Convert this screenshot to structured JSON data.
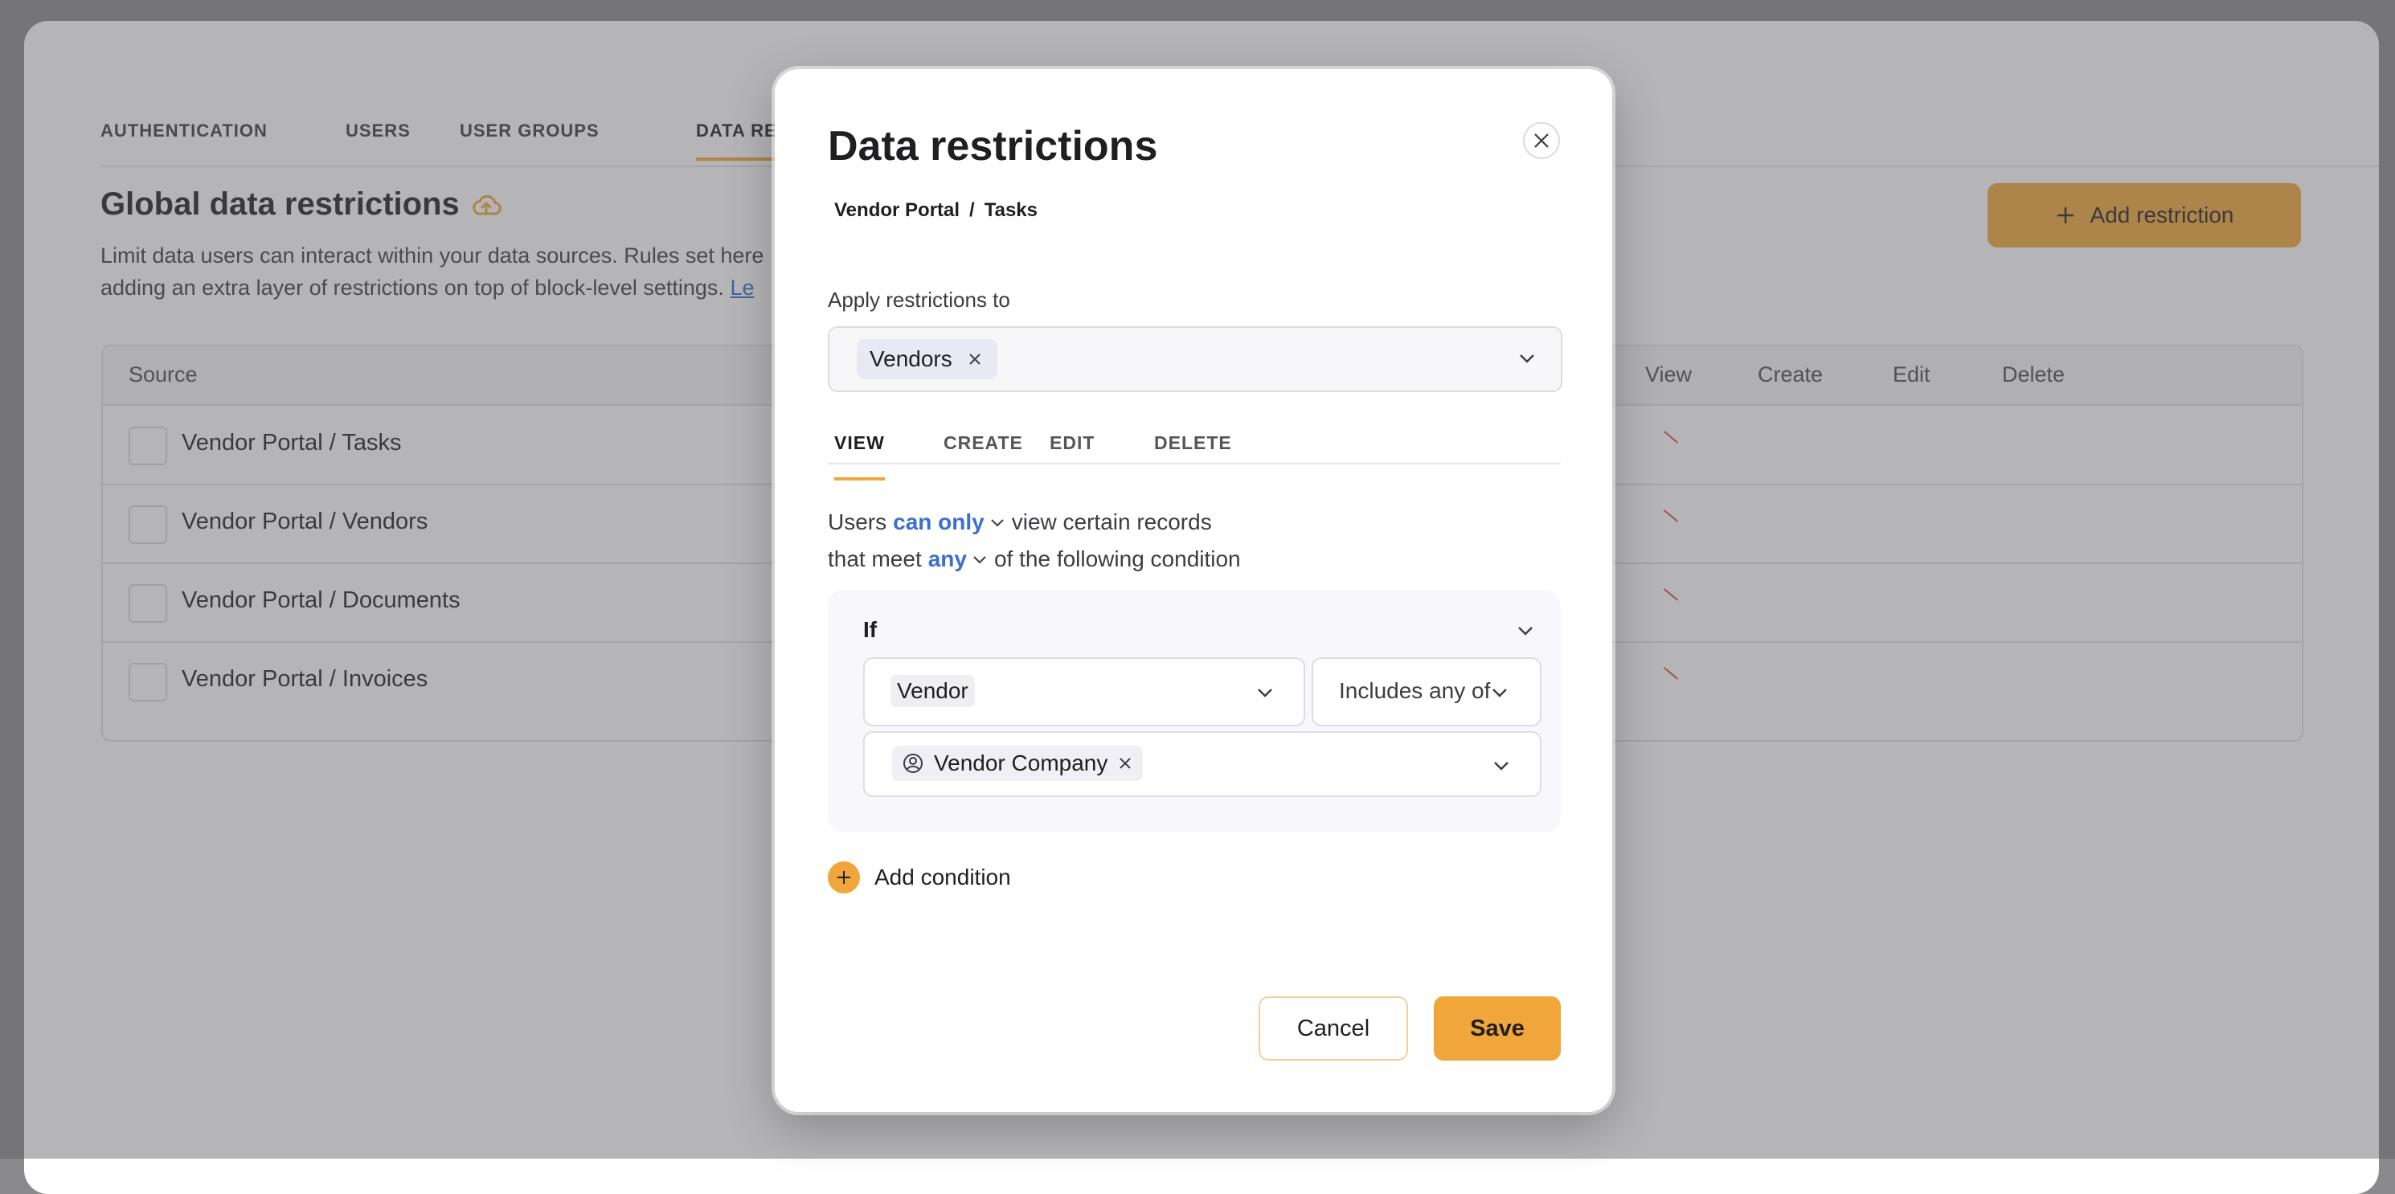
{
  "background": {
    "tabs": [
      "AUTHENTICATION",
      "USERS",
      "USER GROUPS",
      "DATA RESTRICTIONS"
    ],
    "active_tab": "DATA RESTRICTIONS",
    "section_title": "Global data restrictions",
    "description_line1": "Limit data users can interact within your data sources. Rules set here",
    "description_line2": "adding an extra layer of restrictions on top of block-level settings.",
    "learn_link": "Le",
    "add_restriction_label": "Add restriction",
    "table_headers": {
      "source": "Source",
      "view": "View",
      "create": "Create",
      "edit": "Edit",
      "delete": "Delete"
    },
    "rows": [
      {
        "source": "Vendor Portal / Tasks"
      },
      {
        "source": "Vendor Portal / Vendors"
      },
      {
        "source": "Vendor Portal / Documents"
      },
      {
        "source": "Vendor Portal / Invoices"
      }
    ]
  },
  "modal": {
    "title": "Data restrictions",
    "breadcrumb": [
      "Vendor Portal",
      "/",
      "Tasks"
    ],
    "apply_label": "Apply restrictions to",
    "apply_chip": "Vendors",
    "tabs": [
      "VIEW",
      "CREATE",
      "EDIT",
      "DELETE"
    ],
    "active_tab": "VIEW",
    "sentence1": {
      "prefix": "Users",
      "mode": "can only",
      "suffix": "view certain records"
    },
    "sentence2": {
      "prefix": "that meet",
      "mode": "any",
      "suffix": "of the following condition"
    },
    "condition": {
      "label": "If",
      "field": "Vendor",
      "operator": "Includes any of",
      "value_chip": "Vendor Company"
    },
    "add_condition_label": "Add condition",
    "cancel_label": "Cancel",
    "save_label": "Save"
  },
  "colors": {
    "accent": "#f0a63a",
    "link": "#3b6fd0",
    "overlay": "#8a898d"
  }
}
